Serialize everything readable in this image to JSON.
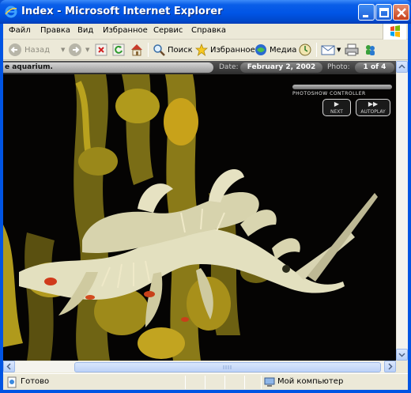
{
  "window": {
    "title": "Index - Microsoft Internet Explorer"
  },
  "menu": {
    "items": [
      "Файл",
      "Правка",
      "Вид",
      "Избранное",
      "Сервис",
      "Справка"
    ]
  },
  "toolbar": {
    "back_label": "Назад",
    "search_label": "Поиск",
    "favorites_label": "Избранное",
    "media_label": "Медиа"
  },
  "page": {
    "caption": "e aquarium.",
    "date_label": "Date:",
    "date_value": "February 2, 2002",
    "photo_label": "Photo:",
    "photo_value": "1 of 4",
    "controller": {
      "title": "PHOTOSHOW CONTROLLER",
      "next_label": "NEXT",
      "autoplay_label": "AUTOPLAY"
    }
  },
  "statusbar": {
    "status": "Готово",
    "zone": "Мой компьютер"
  },
  "colors": {
    "titlebar": "#0055e6",
    "chrome": "#ece9d8",
    "photo_background": "#000000",
    "seadragon_yellow": "#c8a21a"
  }
}
